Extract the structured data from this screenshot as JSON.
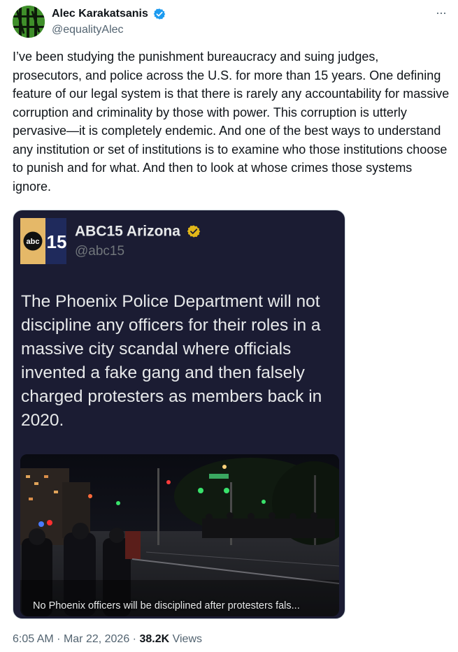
{
  "author": {
    "display_name": "Alec Karakatsanis",
    "handle": "@equalityAlec",
    "verified_color": "#1d9bf0"
  },
  "more_icon": "···",
  "tweet": {
    "text": "I’ve been studying the punishment bureaucracy and suing judges, prosecutors, and police across the U.S. for more than 15 years. One defining feature of our legal system is that there is rarely any accountability for massive corruption and criminality by those with power. This corruption is utterly pervasive—it is completely endemic. And one of the best ways to understand any institution or set of institutions is to examine who those institutions choose to punish and for what. And then to look at whose crimes those systems ignore."
  },
  "embedded_post": {
    "display_name": "ABC15 Arizona",
    "handle": "@abc15",
    "logo_text_abc": "abc",
    "logo_text_number": "15",
    "verified_color": "#e2b719",
    "text": "The Phoenix Police Department will not discipline any officers for their roles in a massive city scandal where officials invented a fake gang and then falsely charged protesters as members back in 2020.",
    "video_caption": "No Phoenix officers will be disciplined after protesters fals..."
  },
  "meta": {
    "time": "6:05 AM",
    "separator": "·",
    "date": "Mar 22, 2026",
    "views_count": "38.2K",
    "views_label": "Views"
  }
}
